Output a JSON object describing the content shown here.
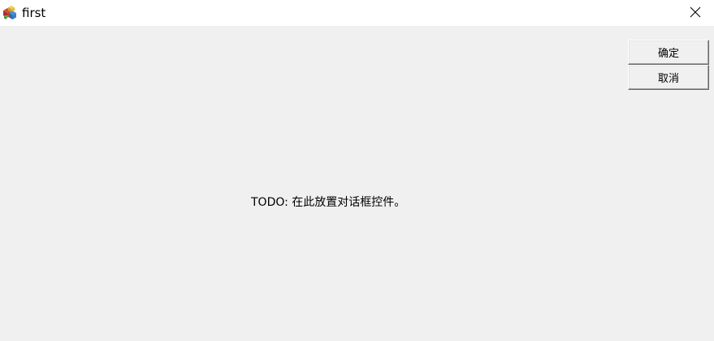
{
  "window": {
    "title": "first",
    "app_icon": "mfc-app-icon",
    "close_icon": "close-icon"
  },
  "dialog": {
    "ok_label": "确定",
    "cancel_label": "取消",
    "todo_text": "TODO: 在此放置对话框控件。"
  }
}
